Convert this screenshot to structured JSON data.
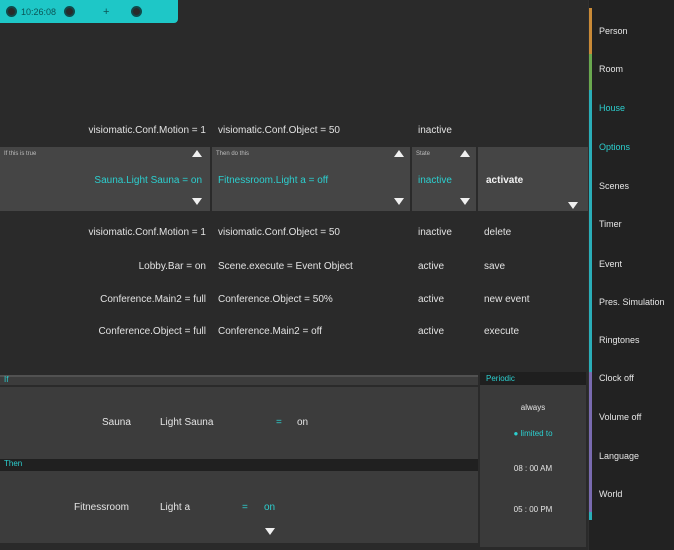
{
  "status": {
    "clock": "10:26:08",
    "plus": "+"
  },
  "colors": {
    "accent": "#2ccfcf",
    "person_bar": "#c98a37",
    "room_bar": "#6aa84f",
    "house_bar": "#2aaeb8",
    "clock_bar": "#7a6bb0"
  },
  "rules": {
    "header_row": {
      "if": "visiomatic.Conf.Motion = 1",
      "then": "visiomatic.Conf.Object = 50",
      "state": "inactive",
      "action": ""
    },
    "selector": {
      "if_label": "If this is true",
      "then_label": "Then do this",
      "state_label": "State",
      "if_value": "Sauna.Light Sauna = on",
      "then_value": "Fitnessroom.Light a = off",
      "state_value": "inactive",
      "action_value": "activate"
    },
    "rows": [
      {
        "if": "visiomatic.Conf.Motion = 1",
        "then": "visiomatic.Conf.Object = 50",
        "state": "inactive",
        "action": "delete"
      },
      {
        "if": "Lobby.Bar = on",
        "then": "Scene.execute = Event Object",
        "state": "active",
        "action": "save"
      },
      {
        "if": "Conference.Main2 = full",
        "then": "Conference.Object = 50%",
        "state": "active",
        "action": "new event"
      },
      {
        "if": "Conference.Object = full",
        "then": "Conference.Main2 = off",
        "state": "active",
        "action": "execute"
      }
    ]
  },
  "if_section": {
    "title": "If",
    "room": "Sauna",
    "device": "Light Sauna",
    "op": "=",
    "value": "on"
  },
  "then_section": {
    "title": "Then",
    "room": "Fitnessroom",
    "device": "Light a",
    "op": "=",
    "value": "on"
  },
  "periodic": {
    "title": "Periodic",
    "always": "always",
    "limited": "limited to",
    "from": "08 : 00 AM",
    "to": "05 : 00 PM"
  },
  "sidebar": {
    "items": [
      {
        "label": "Person"
      },
      {
        "label": "Room"
      },
      {
        "label": "House"
      },
      {
        "label": "Options"
      },
      {
        "label": "Scenes"
      },
      {
        "label": "Timer"
      },
      {
        "label": "Event"
      },
      {
        "label": "Pres. Simulation"
      },
      {
        "label": "Ringtones"
      },
      {
        "label": "Clock off"
      },
      {
        "label": "Volume off"
      },
      {
        "label": "Language"
      },
      {
        "label": "World"
      }
    ]
  }
}
